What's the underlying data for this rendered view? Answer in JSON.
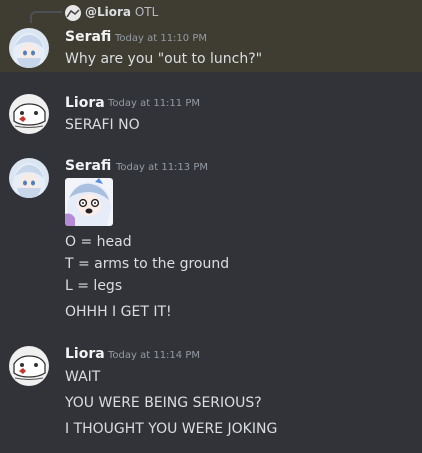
{
  "messages": [
    {
      "author": "Serafi",
      "timestamp": "Today at 11:10 PM",
      "reply": {
        "author": "@Liora",
        "text": "OTL"
      },
      "lines": [
        "Why are you \"out to lunch?\""
      ]
    },
    {
      "author": "Liora",
      "timestamp": "Today at 11:11 PM",
      "lines": [
        "SERAFI NO"
      ]
    },
    {
      "author": "Serafi",
      "timestamp": "Today at 11:13 PM",
      "lines": [
        "O = head",
        "T = arms to the ground",
        "L = legs",
        "OHHH I GET IT!"
      ]
    },
    {
      "author": "Liora",
      "timestamp": "Today at 11:14 PM",
      "lines": [
        "WAIT",
        "YOU WERE BEING SERIOUS?",
        "I THOUGHT YOU WERE JOKING"
      ]
    }
  ],
  "colors": {
    "background": "#313338",
    "reply_highlight": "#3f3d32",
    "username": "#f2f3f5",
    "timestamp": "#949ba4",
    "text": "#dbdee1"
  },
  "icons": {
    "serafi_avatar": "anime-girl-avatar",
    "liora_avatar": "sketch-avatar",
    "emote": "shocked-face-emote"
  }
}
